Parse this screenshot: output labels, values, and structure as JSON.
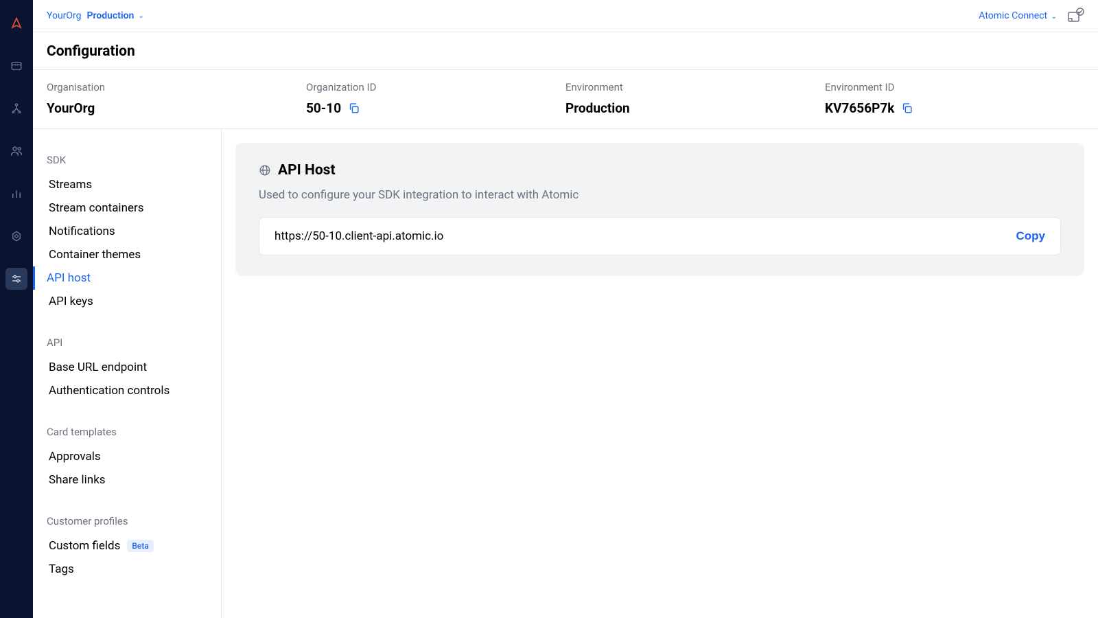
{
  "topbar": {
    "org": "YourOrg",
    "env": "Production",
    "connect": "Atomic Connect"
  },
  "page": {
    "title": "Configuration"
  },
  "info": {
    "org_label": "Organisation",
    "org_value": "YourOrg",
    "orgid_label": "Organization ID",
    "orgid_value": "50-10",
    "env_label": "Environment",
    "env_value": "Production",
    "envid_label": "Environment ID",
    "envid_value": "KV7656P7k"
  },
  "sidenav": {
    "sections": {
      "sdk": {
        "label": "SDK",
        "items": [
          "Streams",
          "Stream containers",
          "Notifications",
          "Container themes",
          "API host",
          "API keys"
        ]
      },
      "api": {
        "label": "API",
        "items": [
          "Base URL endpoint",
          "Authentication controls"
        ]
      },
      "cards": {
        "label": "Card templates",
        "items": [
          "Approvals",
          "Share links"
        ]
      },
      "profiles": {
        "label": "Customer profiles",
        "items": [
          "Custom fields",
          "Tags"
        ],
        "badge": "Beta"
      }
    }
  },
  "content": {
    "title": "API Host",
    "subtitle": "Used to configure your SDK integration to interact with Atomic",
    "url": "https://50-10.client-api.atomic.io",
    "copy_label": "Copy"
  }
}
